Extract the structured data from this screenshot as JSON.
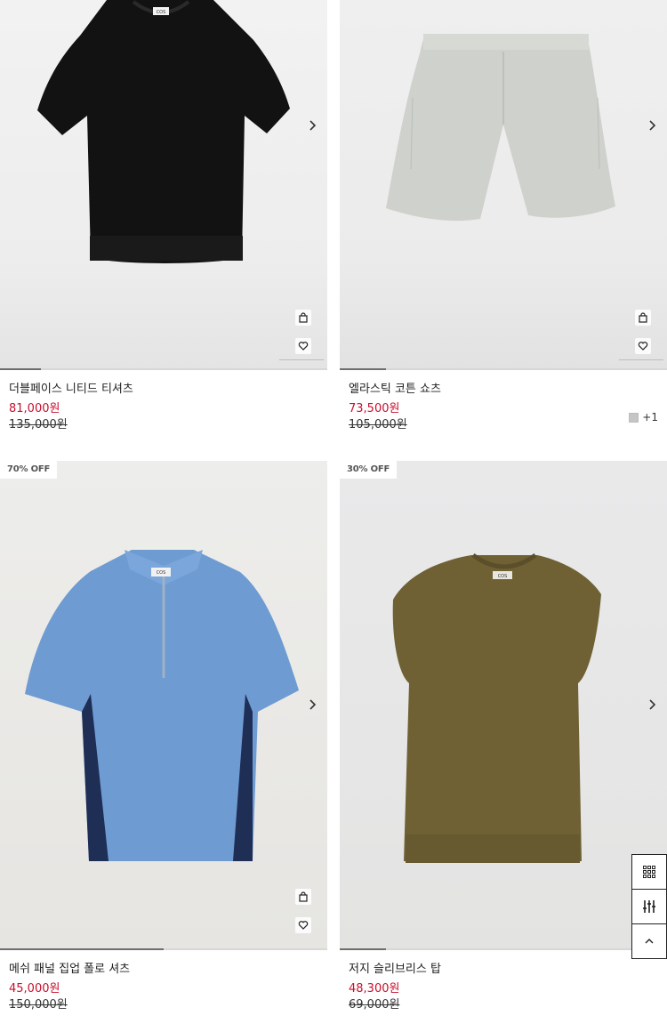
{
  "products": [
    {
      "name": "더블페이스 니티드 티셔츠",
      "sale_price": "81,000원",
      "original_price": "135,000원",
      "badge": "",
      "garment": "black-knit-tshirt",
      "color": "#111111"
    },
    {
      "name": "엘라스틱 코튼 쇼츠",
      "sale_price": "73,500원",
      "original_price": "105,000원",
      "badge": "",
      "garment": "grey-shorts",
      "color": "#c9cbc6",
      "extra_colors": "+1",
      "swatch_color": "#c5c5c5"
    },
    {
      "name": "메쉬 패널 집업 폴로 셔츠",
      "sale_price": "45,000원",
      "original_price": "150,000원",
      "badge": "70% OFF",
      "garment": "blue-zip-polo",
      "color": "#6d9bd1"
    },
    {
      "name": "저지 슬리브리스 탑",
      "sale_price": "48,300원",
      "original_price": "69,000원",
      "badge": "30% OFF",
      "garment": "olive-sleeveless-top",
      "color": "#6f6033"
    }
  ],
  "brand_label": "COS",
  "icons": {
    "next": "chevron-right-icon",
    "bag": "shopping-bag-icon",
    "wish": "heart-icon",
    "grid": "grid-view-icon",
    "filter": "filter-sliders-icon",
    "top": "chevron-up-icon"
  },
  "colors": {
    "sale": "#c8102e",
    "text": "#222222"
  }
}
